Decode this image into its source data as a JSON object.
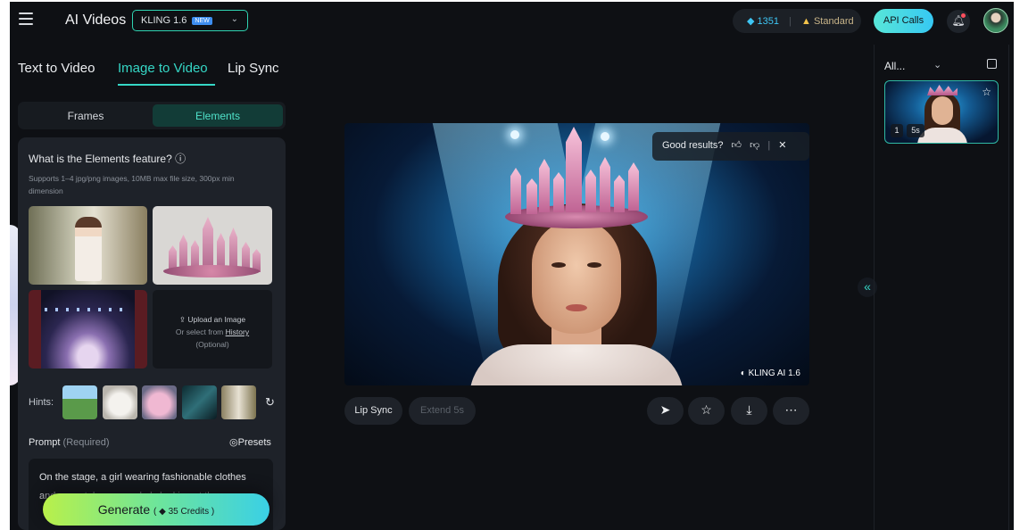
{
  "header": {
    "app_title": "AI Videos",
    "model": "KLING 1.6",
    "model_badge": "NEW",
    "credits": "1351",
    "plan": "Standard",
    "api_button": "API Calls"
  },
  "tabs": [
    {
      "label": "Text to Video"
    },
    {
      "label": "Image to Video"
    },
    {
      "label": "Lip Sync"
    }
  ],
  "mode_tabs": [
    {
      "label": "Frames"
    },
    {
      "label": "Elements"
    }
  ],
  "elements": {
    "question": "What is the Elements feature? ⓘ",
    "hint": "Supports 1–4 jpg/png images, 10MB max file size, 300px min dimension",
    "upload_label": "Upload an Image",
    "upload_or": "Or select from",
    "upload_history": "History",
    "upload_optional": "(Optional)"
  },
  "hints": {
    "label": "Hints:"
  },
  "prompt": {
    "label": "Prompt",
    "required": "(Required)",
    "presets": "Presets",
    "text": "On the stage, a girl wearing fashionable clothes and a crystal crown, calmly looking at the camera"
  },
  "generate": {
    "label": "Generate",
    "credits": "35 Credits"
  },
  "video": {
    "feedback": "Good results?",
    "watermark": "KLING AI 1.6",
    "lip_sync": "Lip Sync",
    "extend": "Extend 5s"
  },
  "history": {
    "filter": "All...",
    "index": "1",
    "duration": "5s"
  }
}
